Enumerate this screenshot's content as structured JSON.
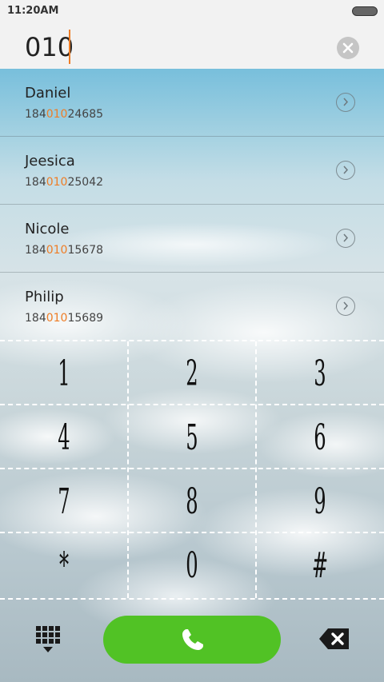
{
  "status_bar": {
    "time": "11:20AM"
  },
  "dial": {
    "input_value": "010"
  },
  "contacts": [
    {
      "name": "Daniel",
      "number_prefix": "184",
      "number_match": "010",
      "number_suffix": "24685"
    },
    {
      "name": "Jeesica",
      "number_prefix": "184",
      "number_match": "010",
      "number_suffix": "25042"
    },
    {
      "name": "Nicole",
      "number_prefix": "184",
      "number_match": "010",
      "number_suffix": "15678"
    },
    {
      "name": "Philip",
      "number_prefix": "184",
      "number_match": "010",
      "number_suffix": "15689"
    }
  ],
  "keypad": {
    "keys": [
      "1",
      "2",
      "3",
      "4",
      "5",
      "6",
      "7",
      "8",
      "9",
      "*",
      "0",
      "#"
    ]
  },
  "icons": {
    "clear": "close-circle-icon",
    "contact_detail": "chevron-right-circle-icon",
    "keypad_toggle": "dialpad-icon",
    "call": "phone-icon",
    "backspace": "backspace-icon"
  },
  "colors": {
    "accent": "#ee7d26",
    "call_button": "#51c225"
  }
}
